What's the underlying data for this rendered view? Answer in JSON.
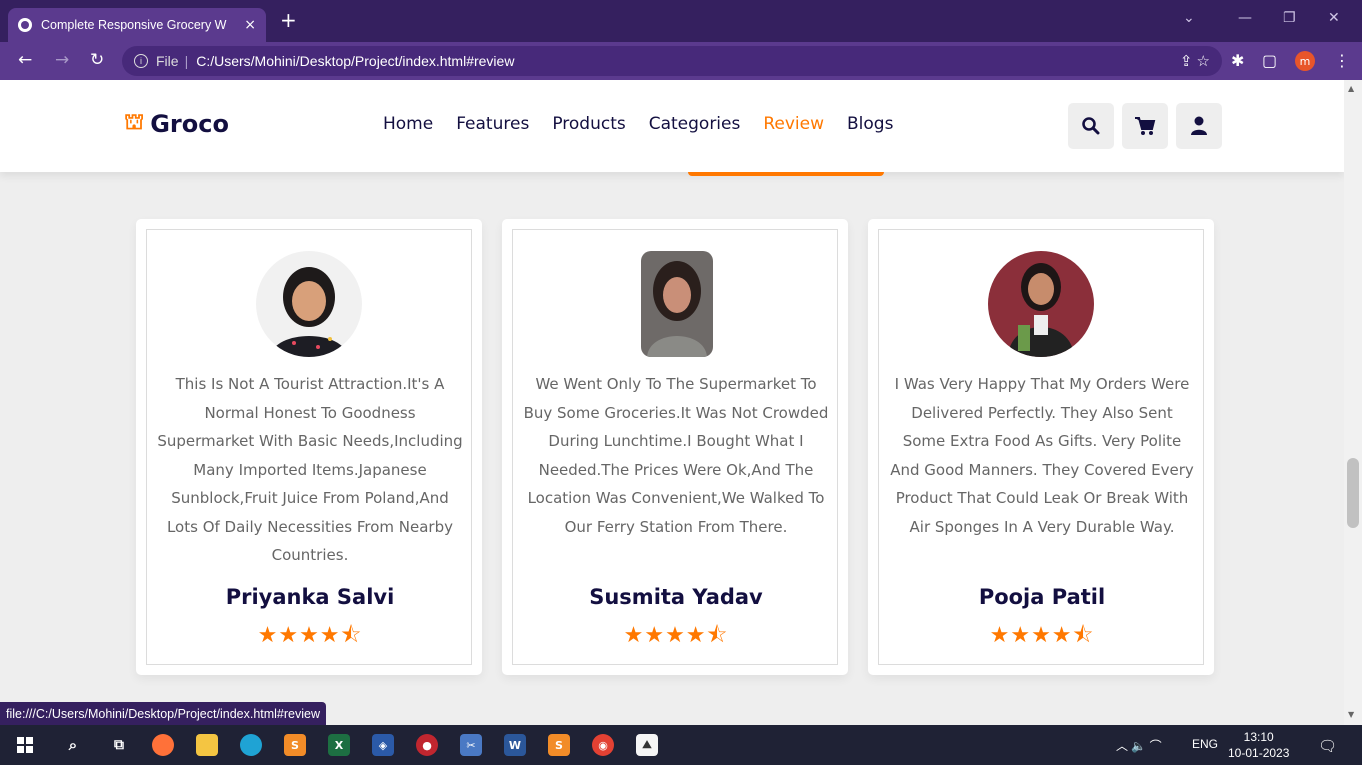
{
  "browser": {
    "tab_title": "Complete Responsive Grocery W",
    "tab_close": "×",
    "new_tab": "+",
    "protocol": "File",
    "url": "C:/Users/Mohini/Desktop/Project/index.html#review",
    "profile_initial": "m",
    "status_url": "file:///C:/Users/Mohini/Desktop/Project/index.html#review"
  },
  "site": {
    "brand": "Groco",
    "nav": [
      "Home",
      "Features",
      "Products",
      "Categories",
      "Review",
      "Blogs"
    ],
    "active_nav": "Review",
    "accent_color": "#ff7800",
    "text_color": "#130f40"
  },
  "reviews": [
    {
      "text": "This Is Not A Tourist Attraction.It's A Normal Honest To Goodness Supermarket With Basic Needs,Including Many Imported Items.Japanese Sunblock,Fruit Juice From Poland,And Lots Of Daily Necessities From Nearby Countries.",
      "name": "Priyanka Salvi",
      "rating": 4.5,
      "stars": "★★★★⯪"
    },
    {
      "text": "We Went Only To The Supermarket To Buy Some Groceries.It Was Not Crowded During Lunchtime.I Bought What I Needed.The Prices Were Ok,And The Location Was Convenient,We Walked To Our Ferry Station From There.",
      "name": "Susmita Yadav",
      "rating": 4.5,
      "stars": "★★★★⯪"
    },
    {
      "text": "I Was Very Happy That My Orders Were Delivered Perfectly. They Also Sent Some Extra Food As Gifts. Very Polite And Good Manners. They Covered Every Product That Could Leak Or Break With Air Sponges In A Very Durable Way.",
      "name": "Pooja Patil",
      "rating": 4.5,
      "stars": "★★★★⯪"
    }
  ],
  "taskbar": {
    "language": "ENG",
    "time": "13:10",
    "date": "10-01-2023"
  }
}
